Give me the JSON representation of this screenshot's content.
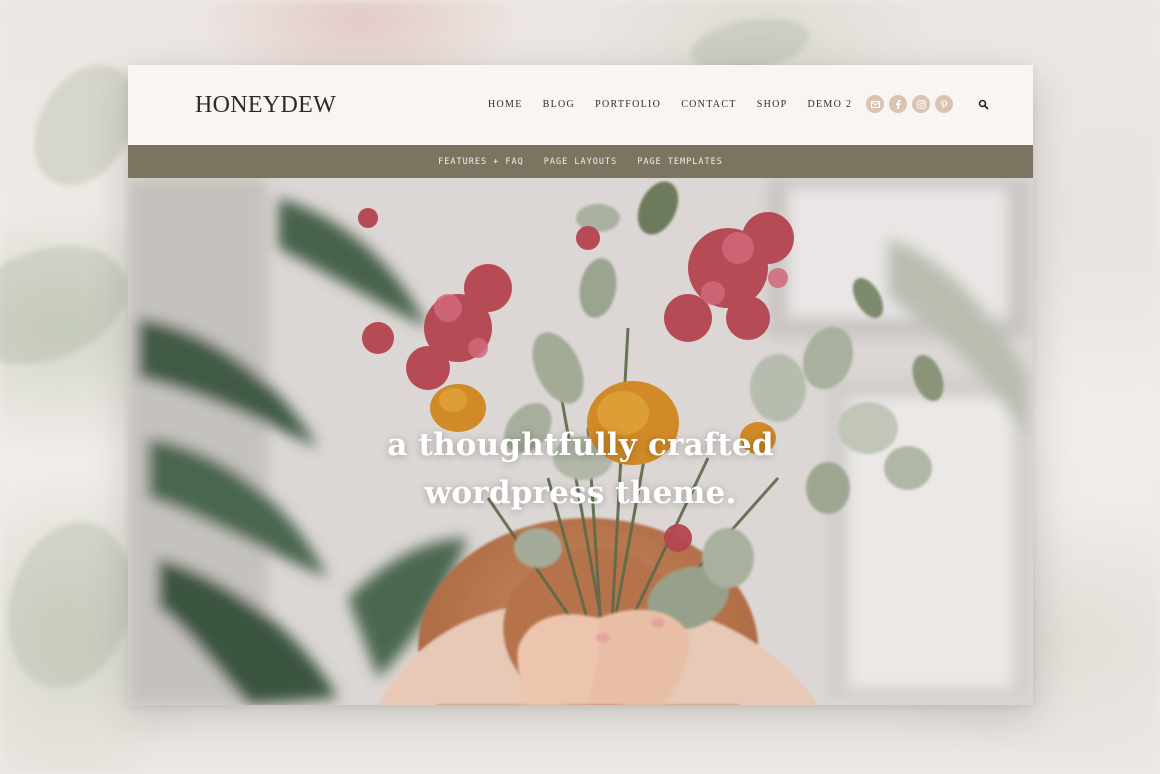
{
  "brand": {
    "logo": "HONEYDEW"
  },
  "main_nav": [
    {
      "label": "HOME",
      "name": "nav-home"
    },
    {
      "label": "BLOG",
      "name": "nav-blog"
    },
    {
      "label": "PORTFOLIO",
      "name": "nav-portfolio"
    },
    {
      "label": "CONTACT",
      "name": "nav-contact"
    },
    {
      "label": "SHOP",
      "name": "nav-shop"
    },
    {
      "label": "DEMO 2",
      "name": "nav-demo-2"
    }
  ],
  "social": [
    {
      "icon": "email-icon"
    },
    {
      "icon": "facebook-icon"
    },
    {
      "icon": "instagram-icon"
    },
    {
      "icon": "pinterest-icon"
    }
  ],
  "search": {
    "icon": "search-icon"
  },
  "sub_nav": [
    {
      "label": "FEATURES + FAQ",
      "name": "subnav-features-faq"
    },
    {
      "label": "PAGE LAYOUTS",
      "name": "subnav-page-layouts"
    },
    {
      "label": "PAGE TEMPLATES",
      "name": "subnav-page-templates"
    }
  ],
  "hero": {
    "line1": "a thoughtfully crafted",
    "line2": "wordpress theme."
  },
  "colors": {
    "header_bg": "#f8f5f3",
    "subnav_bg": "#7b7460",
    "social_bg": "#dcc3b0",
    "text_dark": "#2f2b29"
  }
}
